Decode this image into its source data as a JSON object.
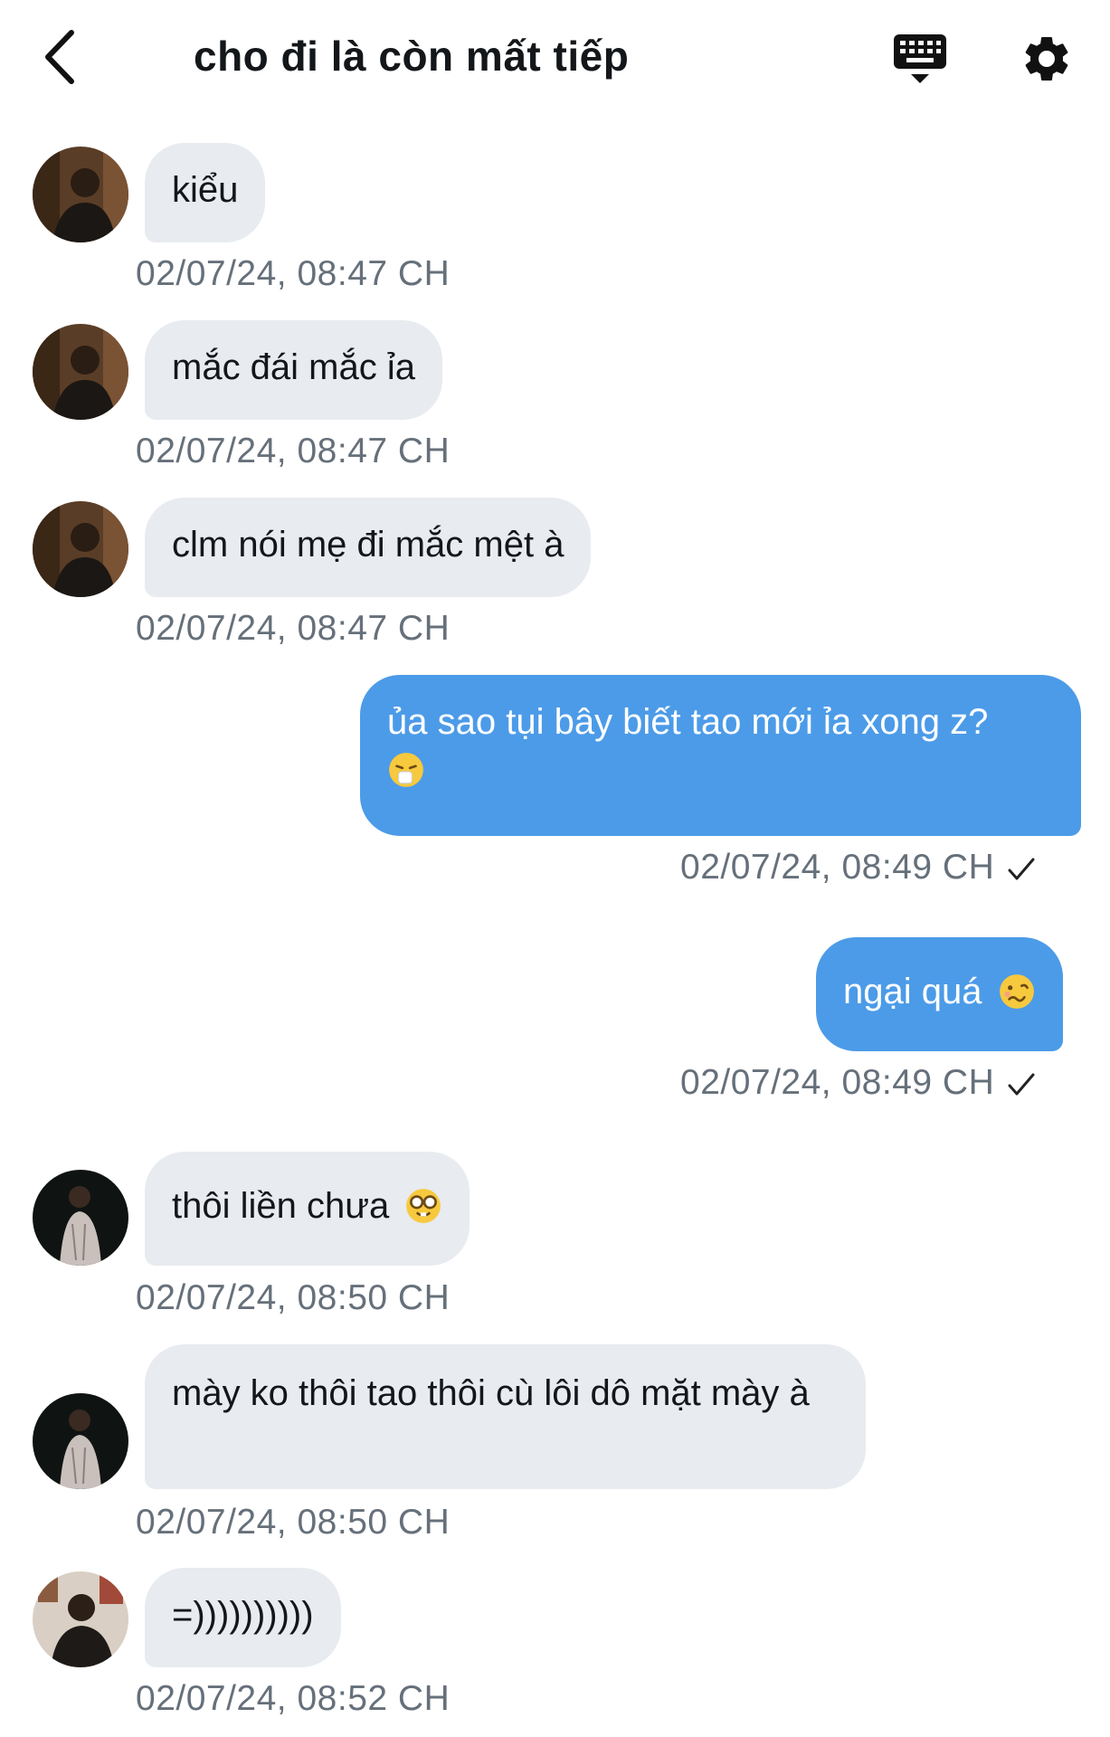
{
  "header": {
    "title": "cho đi là còn mất tiếp",
    "back_icon": "chevron-left-icon",
    "keyboard_icon": "keyboard-icon",
    "settings_icon": "gear-icon"
  },
  "colors": {
    "incoming_bubble": "#e8ebef",
    "outgoing_bubble": "#4c9be8",
    "timestamp": "#66707a"
  },
  "messages": [
    {
      "side": "in",
      "text": "kiểu",
      "time": "02/07/24, 08:47 CH"
    },
    {
      "side": "in",
      "text": "mắc đái mắc ỉa",
      "time": "02/07/24, 08:47 CH"
    },
    {
      "side": "in",
      "text": "clm nói mẹ đi mắc mệt à",
      "time": "02/07/24, 08:47 CH"
    },
    {
      "side": "out",
      "text": "ủa sao tụi bây biết tao mới ỉa xong z?",
      "emoji": "sneezing-face-emoji",
      "time": "02/07/24, 08:49 CH"
    },
    {
      "side": "out",
      "text": "ngại quá",
      "emoji": "woozy-face-emoji",
      "time": "02/07/24, 08:49 CH"
    },
    {
      "side": "in",
      "text": "thôi liền chưa",
      "emoji": "nerd-face-emoji",
      "time": "02/07/24, 08:50 CH"
    },
    {
      "side": "in",
      "text": "mày ko thôi tao thôi cù lôi dô mặt mày à",
      "time": "02/07/24, 08:50 CH"
    },
    {
      "side": "in",
      "text": "=))))))))))",
      "time": "02/07/24, 08:52 CH"
    }
  ]
}
